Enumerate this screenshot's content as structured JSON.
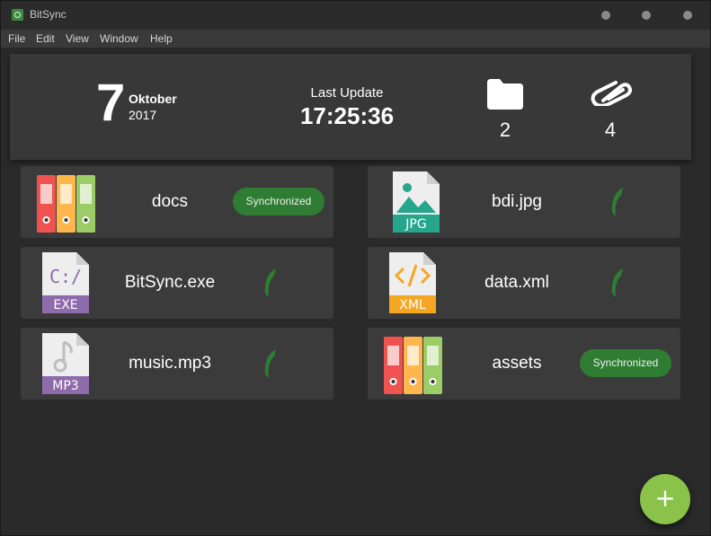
{
  "app": {
    "title": "BitSync"
  },
  "menu": [
    "File",
    "Edit",
    "View",
    "Window",
    "Help"
  ],
  "header": {
    "day": "7",
    "month": "Oktober",
    "year": "2017",
    "last_update_label": "Last Update",
    "last_update_time": "17:25:36",
    "folder_count": "2",
    "file_count": "4"
  },
  "items": [
    {
      "name": "docs",
      "type": "folder",
      "status": "Synchronized"
    },
    {
      "name": "bdi.jpg",
      "type": "jpg",
      "file_label": "JPG",
      "status": "syncing"
    },
    {
      "name": "BitSync.exe",
      "type": "exe",
      "file_label": "EXE",
      "status": "syncing"
    },
    {
      "name": "data.xml",
      "type": "xml",
      "file_label": "XML",
      "status": "syncing"
    },
    {
      "name": "music.mp3",
      "type": "mp3",
      "file_label": "MP3",
      "status": "syncing"
    },
    {
      "name": "assets",
      "type": "folder",
      "status": "Synchronized"
    }
  ],
  "fab": {
    "label": "+"
  },
  "colors": {
    "accent": "#8bc34a",
    "synced": "#2e7d32",
    "jpg": "#26a68a",
    "exe": "#8e6bab",
    "xml": "#f5a623",
    "mp3": "#8e6bab"
  }
}
